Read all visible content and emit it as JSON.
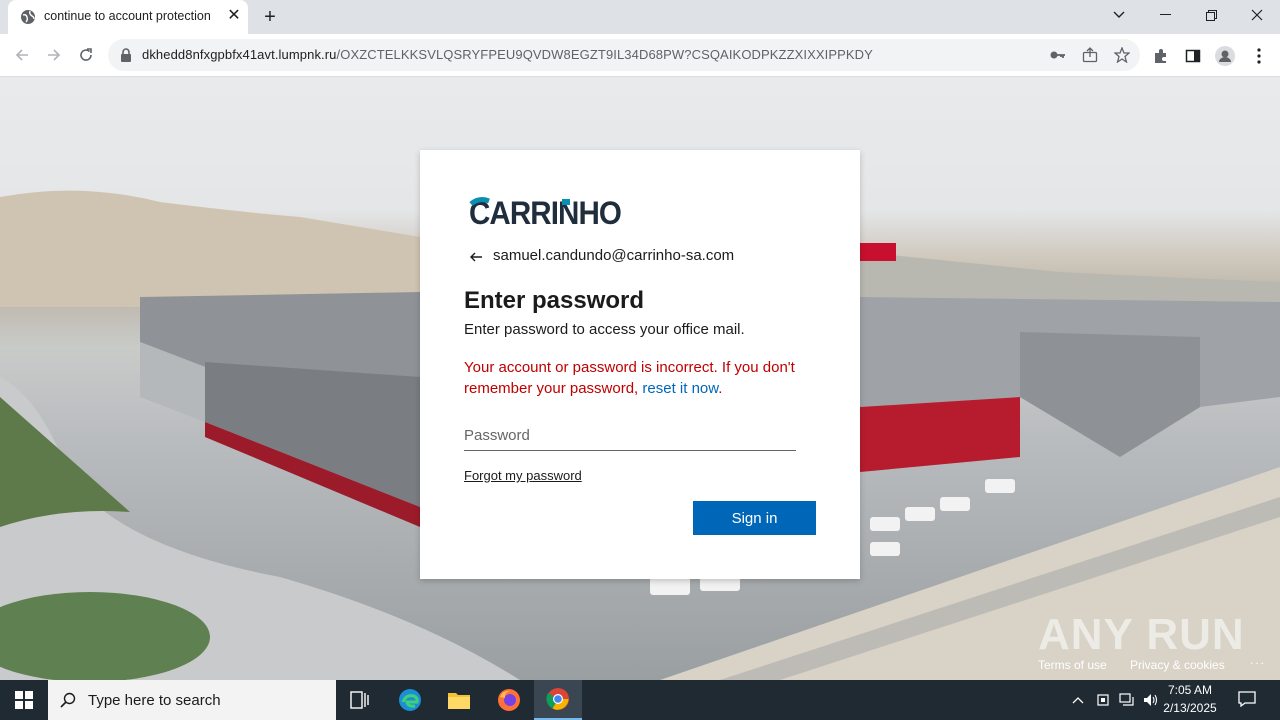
{
  "browser": {
    "tab_title": "continue to account protection",
    "url_host": "dkhedd8nfxgpbfx41avt.lumpnk.ru",
    "url_path": "/OXZCTELKKSVLQSRYFPEU9QVDW8EGZT9IL34D68PW?CSQAIKODPKZZXIXXIPPKDY"
  },
  "login": {
    "logo_text": "CARRINHO",
    "email": "samuel.candundo@carrinho-sa.com",
    "heading": "Enter password",
    "subtitle": "Enter password to access your office mail.",
    "error_text": "Your account or password is incorrect. If you don't remember your password, ",
    "reset_link": "reset it now",
    "error_end": ".",
    "password_placeholder": "Password",
    "forgot_link": "Forgot my password",
    "signin_label": "Sign in"
  },
  "footer": {
    "terms": "Terms of use",
    "privacy": "Privacy & cookies",
    "more": "..."
  },
  "watermark": "ANY RUN",
  "taskbar": {
    "search_placeholder": "Type here to search",
    "time": "7:05 AM",
    "date": "2/13/2025"
  },
  "colors": {
    "accent": "#0067b8",
    "error": "#c00000",
    "logo_dark": "#1f2d3d",
    "logo_teal": "#0a8fb0"
  }
}
